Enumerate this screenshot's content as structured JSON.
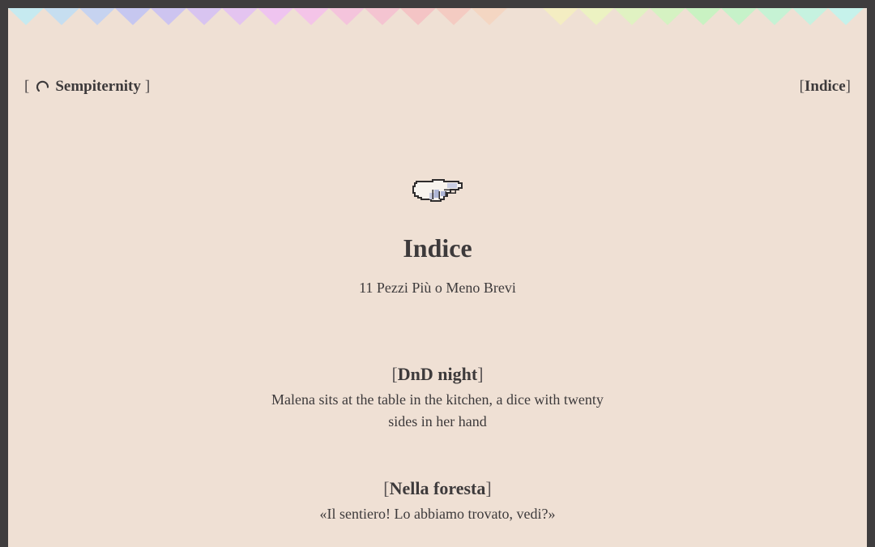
{
  "header": {
    "brand": {
      "open_bracket": "[",
      "name": "Sempiternity",
      "close_bracket": "]",
      "icon": "spinner-icon"
    },
    "nav": {
      "open_bracket": "[",
      "label": "Indice",
      "close_bracket": "]"
    }
  },
  "decor": {
    "bunting_icon": "bunting-flags",
    "hand_icon": "pointing-hand-icon"
  },
  "main": {
    "title": "Indice",
    "subtitle": "11 Pezzi Più o Meno Brevi",
    "entries": [
      {
        "open_bracket": "[",
        "title": "DnD night",
        "close_bracket": "]",
        "description": "Malena sits at the table in the kitchen, a dice with twenty sides in her hand"
      },
      {
        "open_bracket": "[",
        "title": "Nella foresta",
        "close_bracket": "]",
        "description": "«Il sentiero! Lo abbiamo trovato, vedi?»"
      }
    ]
  },
  "colors": {
    "background": "#efe0d4",
    "frame": "#3f3d3e",
    "text": "#3d3a3b"
  }
}
